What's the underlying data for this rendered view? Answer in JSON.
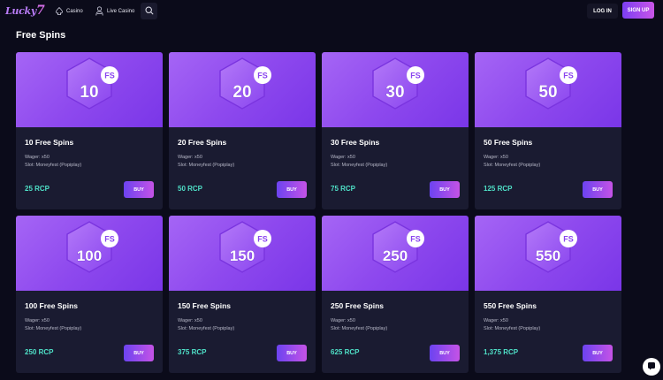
{
  "header": {
    "logo_text": "Lucky",
    "logo_seven": "7",
    "nav": [
      {
        "label": "Casino",
        "icon": "spade-icon"
      },
      {
        "label": "Live Casino",
        "icon": "dealer-icon"
      }
    ],
    "search_icon": "search-icon",
    "login_label": "LOG IN",
    "signup_label": "SIGN UP"
  },
  "section": {
    "title": "Free Spins"
  },
  "badge_label": "FS",
  "cards": [
    {
      "amount": "10",
      "title": "10 Free Spins",
      "wager": "Wager: x50",
      "slot": "Slot: Moneyfest (Popiplay)",
      "price": "25 RCP",
      "buy_label": "BUY"
    },
    {
      "amount": "20",
      "title": "20 Free Spins",
      "wager": "Wager: x50",
      "slot": "Slot: Moneyfest (Popiplay)",
      "price": "50 RCP",
      "buy_label": "BUY"
    },
    {
      "amount": "30",
      "title": "30 Free Spins",
      "wager": "Wager: x50",
      "slot": "Slot: Moneyfest (Popiplay)",
      "price": "75 RCP",
      "buy_label": "BUY"
    },
    {
      "amount": "50",
      "title": "50 Free Spins",
      "wager": "Wager: x50",
      "slot": "Slot: Moneyfest (Popiplay)",
      "price": "125 RCP",
      "buy_label": "BUY"
    },
    {
      "amount": "100",
      "title": "100 Free Spins",
      "wager": "Wager: x50",
      "slot": "Slot: Moneyfest (Popiplay)",
      "price": "250 RCP",
      "buy_label": "BUY"
    },
    {
      "amount": "150",
      "title": "150 Free Spins",
      "wager": "Wager: x50",
      "slot": "Slot: Moneyfest (Popiplay)",
      "price": "375 RCP",
      "buy_label": "BUY"
    },
    {
      "amount": "250",
      "title": "250 Free Spins",
      "wager": "Wager: x50",
      "slot": "Slot: Moneyfest (Popiplay)",
      "price": "625 RCP",
      "buy_label": "BUY"
    },
    {
      "amount": "550",
      "title": "550 Free Spins",
      "wager": "Wager: x50",
      "slot": "Slot: Moneyfest (Popiplay)",
      "price": "1,375 RCP",
      "buy_label": "BUY"
    }
  ],
  "chat_icon": "chat-icon",
  "colors": {
    "background": "#0b0b1a",
    "card": "#1a1b31",
    "card_image": "#9a57f2",
    "price": "#4fe0c7",
    "button_start": "#6c43f0",
    "button_end": "#c553e6"
  }
}
